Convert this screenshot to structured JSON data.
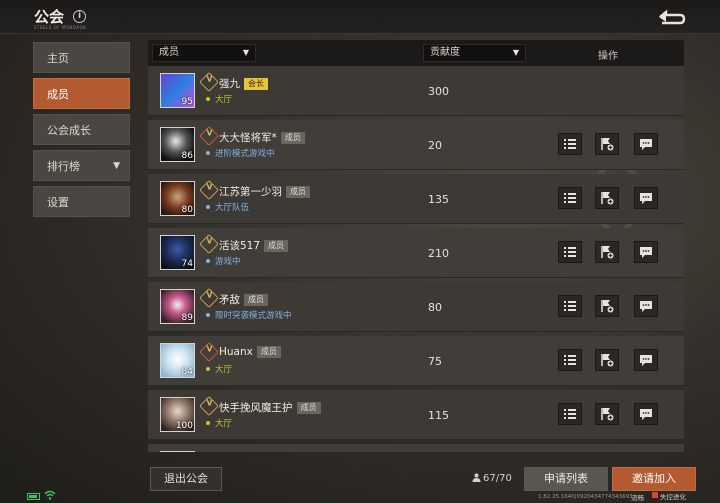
{
  "header": {
    "title": "公会",
    "subtitle": "STEELS OF MONDAOK"
  },
  "sidebar": {
    "items": [
      {
        "label": "主页",
        "active": false
      },
      {
        "label": "成员",
        "active": true
      },
      {
        "label": "公会成长",
        "active": false
      },
      {
        "label": "排行榜",
        "active": false,
        "caret": "▼"
      },
      {
        "label": "设置",
        "active": false
      }
    ]
  },
  "table": {
    "filter_member": "成员",
    "filter_contribution": "贡献度",
    "ops_header": "操作",
    "dropdown_caret": "▼"
  },
  "members": [
    {
      "name": "强九",
      "role": "会长",
      "status": "大厅",
      "status_color": "yellow",
      "contribution": "300",
      "level": "95"
    },
    {
      "name": "大大怪将军*",
      "role": "成员",
      "status": "进阶模式游戏中",
      "status_color": "blue",
      "contribution": "20",
      "level": "86"
    },
    {
      "name": "江苏第一少羽",
      "role": "成员",
      "status": "大厅队伍",
      "status_color": "blue",
      "contribution": "135",
      "level": "80"
    },
    {
      "name": "活该517",
      "role": "成员",
      "status": "游戏中",
      "status_color": "blue",
      "contribution": "210",
      "level": "74"
    },
    {
      "name": "矛敌",
      "role": "成员",
      "status": "限时突袭模式游戏中",
      "status_color": "blue",
      "contribution": "80",
      "level": "89"
    },
    {
      "name": "Huanx",
      "role": "成员",
      "status": "大厅",
      "status_color": "yellow",
      "contribution": "75",
      "level": "84"
    },
    {
      "name": "快手挽风魔王护",
      "role": "成员",
      "status": "大厅",
      "status_color": "yellow",
      "contribution": "115",
      "level": "100"
    }
  ],
  "footer": {
    "leave_button": "退出公会",
    "member_count": "67/70",
    "applications_button": "申请列表",
    "invite_button": "邀请加入",
    "version": "1.82.25.1640|0920434774343693",
    "watermark_text": "流畅",
    "watermark_logo": "失控进化"
  },
  "colors": {
    "accent": "#b35a31",
    "leader_badge": "#e8c43a",
    "status_yellow": "#c9c23a",
    "status_blue": "#7fb2e8"
  },
  "icons": {
    "ops": [
      "list-icon",
      "flag-plus-icon",
      "chat-icon"
    ]
  }
}
